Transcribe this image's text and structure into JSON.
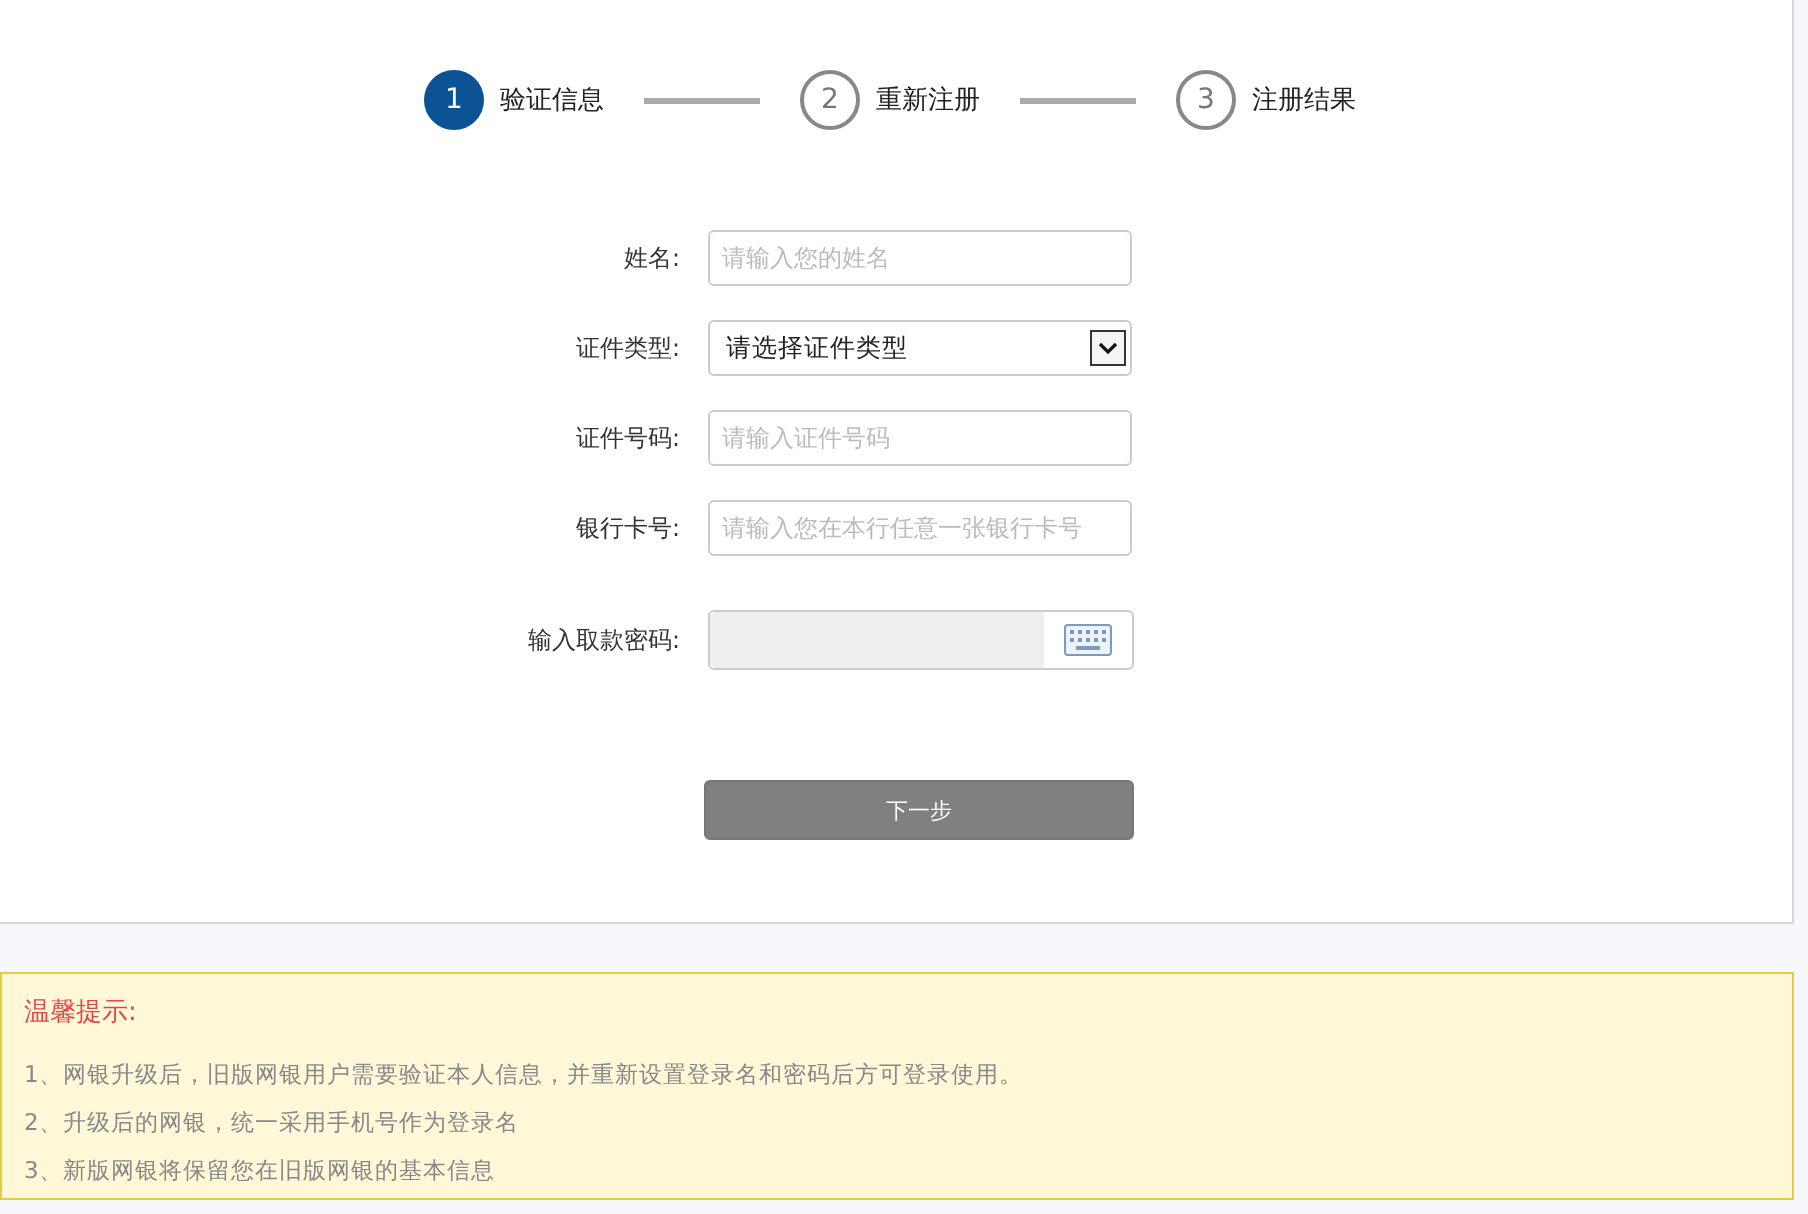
{
  "steps": [
    {
      "number": "1",
      "label": "验证信息",
      "selected": true
    },
    {
      "number": "2",
      "label": "重新注册",
      "selected": false
    },
    {
      "number": "3",
      "label": "注册结果",
      "selected": false
    }
  ],
  "form": {
    "fields": [
      {
        "kind": "text",
        "label": "姓名:",
        "placeholder": "请输入您的姓名"
      },
      {
        "kind": "select",
        "label": "证件类型:",
        "value": "请选择证件类型"
      },
      {
        "kind": "text",
        "label": "证件号码:",
        "placeholder": "请输入证件号码"
      },
      {
        "kind": "text",
        "label": "银行卡号:",
        "placeholder": "请输入您在本行任意一张银行卡号"
      },
      {
        "kind": "password",
        "label": "输入取款密码:"
      }
    ],
    "submit": "下一步"
  },
  "notice": {
    "title": "温馨提示:",
    "items": [
      "1、网银升级后，旧版网银用户需要验证本人信息，并重新设置登录名和密码后方可登录使用。",
      "2、升级后的网银，统一采用手机号作为登录名",
      "3、新版网银将保留您在旧版网银的基本信息"
    ]
  }
}
